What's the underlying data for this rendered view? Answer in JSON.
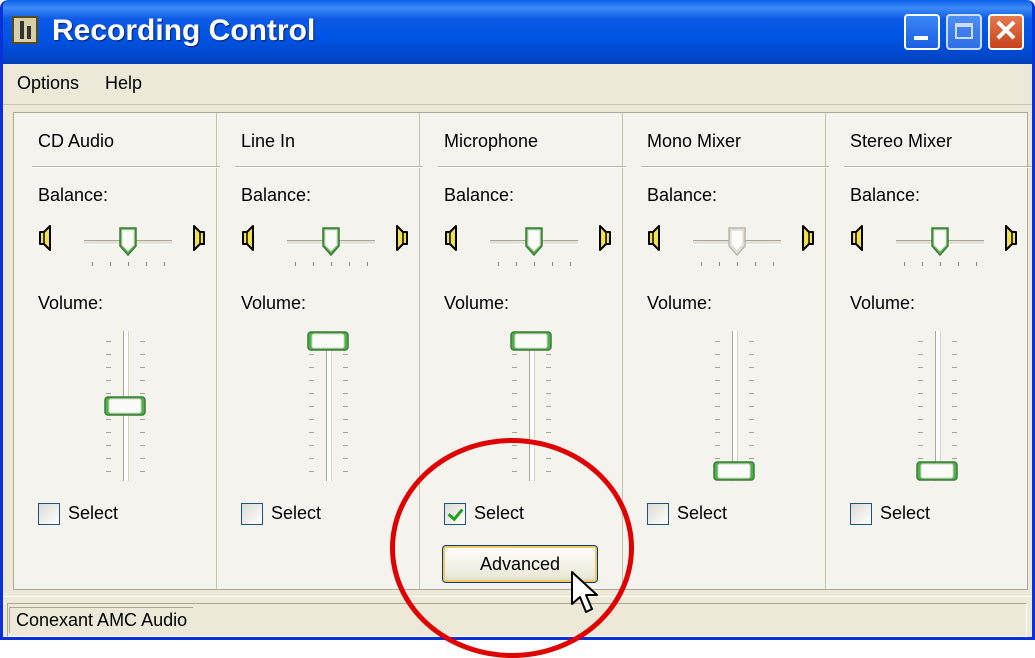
{
  "window": {
    "title": "Recording Control"
  },
  "menu": {
    "items": [
      "Options",
      "Help"
    ]
  },
  "channels": [
    {
      "name": "CD Audio",
      "balance_label": "Balance:",
      "balance": 0.5,
      "volume_label": "Volume:",
      "volume": 0.5,
      "select_label": "Select",
      "selected": false,
      "enabled": true
    },
    {
      "name": "Line In",
      "balance_label": "Balance:",
      "balance": 0.5,
      "volume_label": "Volume:",
      "volume": 1.0,
      "select_label": "Select",
      "selected": false,
      "enabled": true
    },
    {
      "name": "Microphone",
      "balance_label": "Balance:",
      "balance": 0.5,
      "volume_label": "Volume:",
      "volume": 1.0,
      "select_label": "Select",
      "selected": true,
      "enabled": true,
      "advanced_label": "Advanced"
    },
    {
      "name": "Mono Mixer",
      "balance_label": "Balance:",
      "balance": 0.5,
      "volume_label": "Volume:",
      "volume": 0.0,
      "select_label": "Select",
      "selected": false,
      "enabled": false
    },
    {
      "name": "Stereo Mixer",
      "balance_label": "Balance:",
      "balance": 0.5,
      "volume_label": "Volume:",
      "volume": 0.0,
      "select_label": "Select",
      "selected": false,
      "enabled": true
    }
  ],
  "status": {
    "device": "Conexant AMC Audio"
  },
  "colors": {
    "title_bar": "#0054e3",
    "highlight": "#e00000",
    "thumb_green": "#4fb04a"
  },
  "icons": [
    "speaker-left-icon",
    "speaker-right-icon",
    "minimize-icon",
    "maximize-icon",
    "close-icon",
    "mouse-cursor-icon"
  ]
}
